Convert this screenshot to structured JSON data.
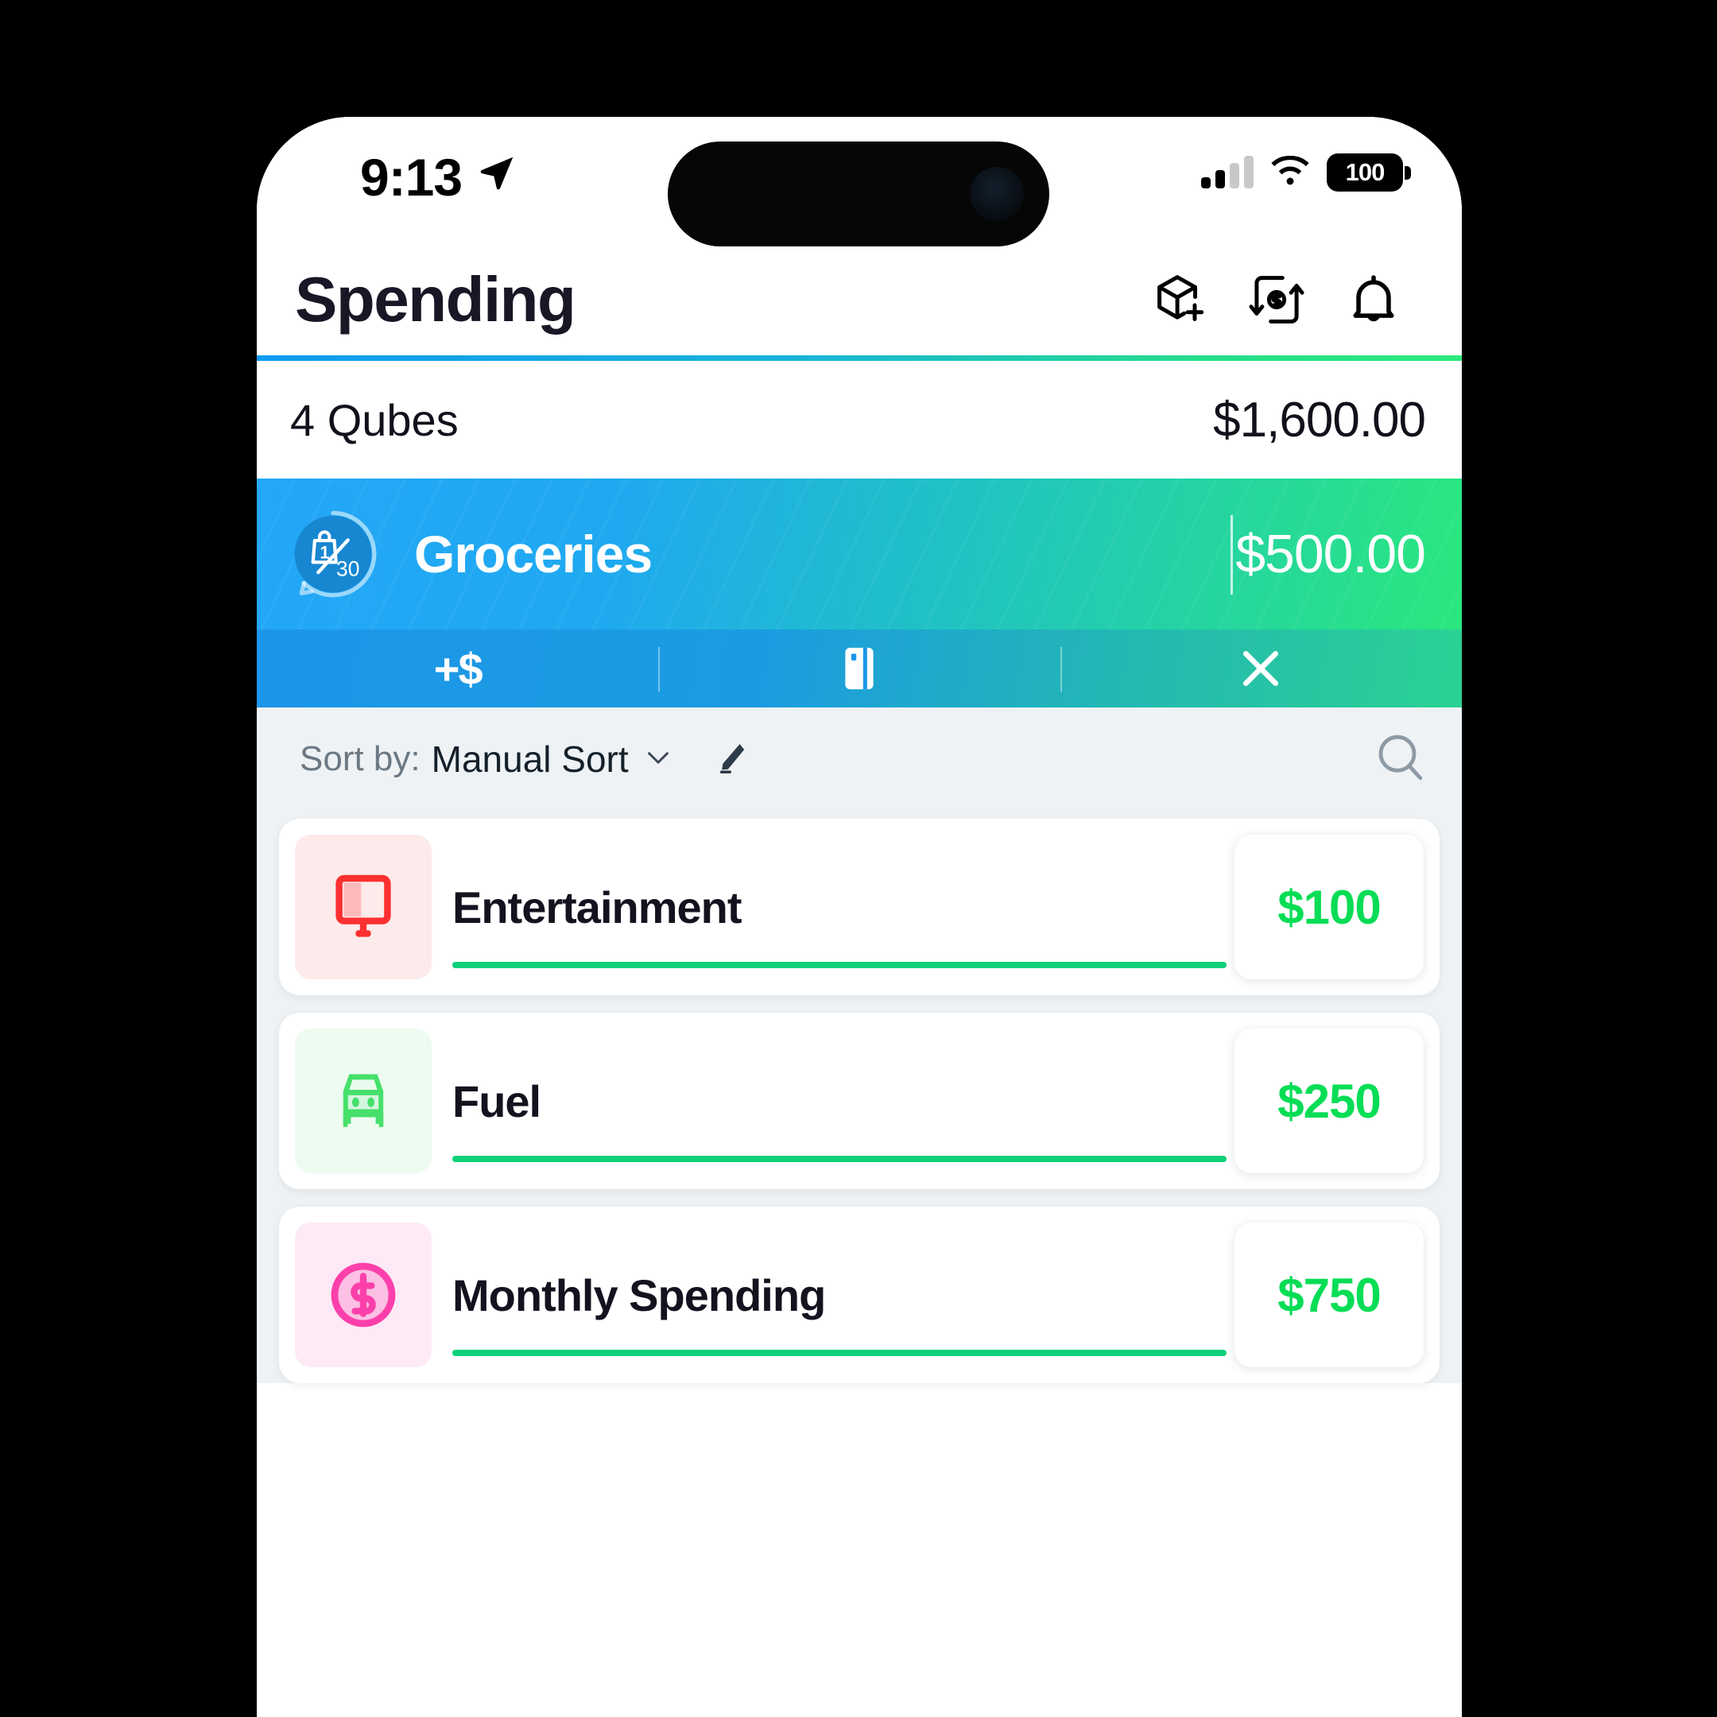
{
  "status_bar": {
    "time": "9:13",
    "location_icon": "location-arrow-icon",
    "signal_icon": "cellular-signal-icon",
    "wifi_icon": "wifi-icon",
    "battery_level": "100"
  },
  "header": {
    "title": "Spending",
    "icons": [
      {
        "name": "add-qube-icon",
        "label": "Add Qube"
      },
      {
        "name": "transfer-money-icon",
        "label": "Transfer"
      },
      {
        "name": "notifications-bell-icon",
        "label": "Notifications"
      }
    ]
  },
  "summary": {
    "label": "4 Qubes",
    "amount": "$1,600.00"
  },
  "featured_qube": {
    "name": "Groceries",
    "amount": "$500.00",
    "cycle_current": "1",
    "cycle_total": "30",
    "icon": "shopping-bag-cycle-icon",
    "actions": [
      {
        "name": "add-funds-action",
        "label": "+$"
      },
      {
        "name": "card-action",
        "label": "card-icon"
      },
      {
        "name": "close-action",
        "label": "close-icon"
      }
    ]
  },
  "sort_bar": {
    "label": "Sort by:",
    "value": "Manual Sort",
    "caret_icon": "chevron-down-icon",
    "edit_icon": "pencil-edit-icon",
    "search_icon": "search-icon"
  },
  "qube_list": [
    {
      "name": "Entertainment",
      "amount": "$100",
      "icon": "monitor-icon",
      "icon_color": "#fc3030",
      "icon_bg": "#fdeaea",
      "progress": 100
    },
    {
      "name": "Fuel",
      "amount": "$250",
      "icon": "car-icon",
      "icon_color": "#46e06a",
      "icon_bg": "#edfbf0",
      "progress": 100
    },
    {
      "name": "Monthly Spending",
      "amount": "$750",
      "icon": "dollar-coin-icon",
      "icon_color": "#fc40ab",
      "icon_bg": "#fdeaf6",
      "progress": 100
    }
  ],
  "colors": {
    "accent_blue": "#23a7f7",
    "accent_green": "#2ae77e",
    "amount_green": "#07dd55",
    "progress_green": "#0ed07a",
    "background": "#eef2f4"
  }
}
